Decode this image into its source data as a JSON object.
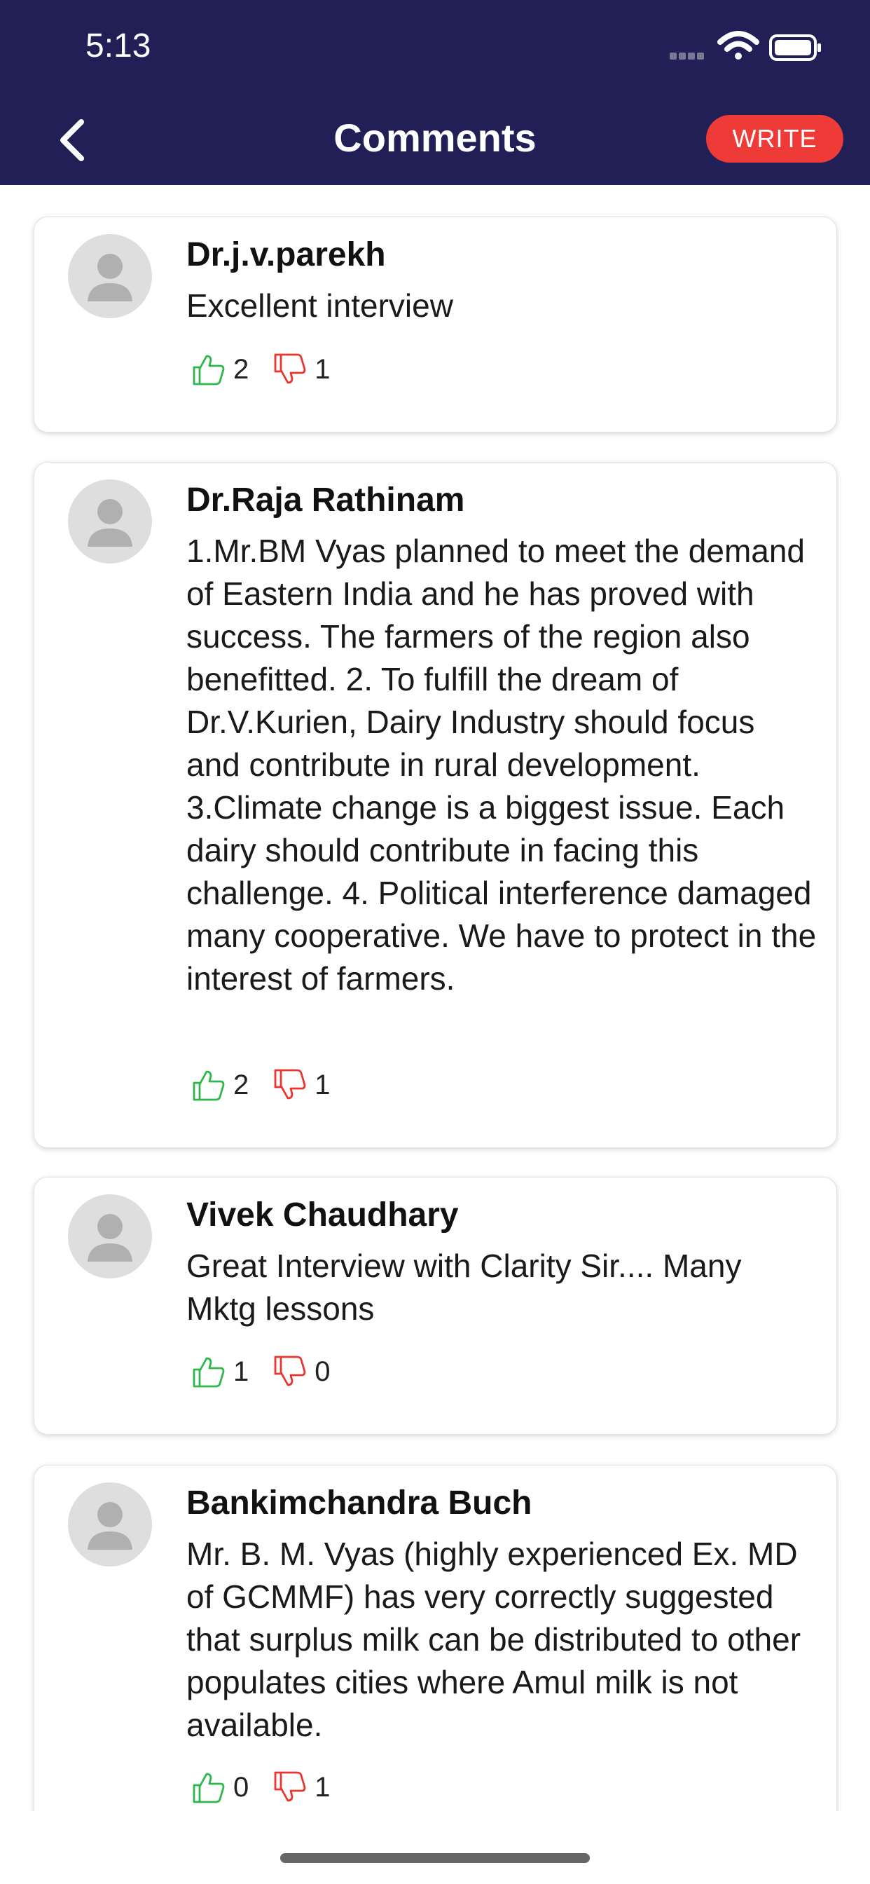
{
  "status_bar": {
    "time": "5:13"
  },
  "nav": {
    "title": "Comments",
    "write_label": "WRITE"
  },
  "comments": [
    {
      "author": "Dr.j.v.parekh",
      "text": "Excellent interview",
      "likes": "2",
      "dislikes": "1"
    },
    {
      "author": "Dr.Raja Rathinam",
      "text": "1.Mr.BM Vyas planned to meet the demand of Eastern India and he has proved with success. The farmers of the region also benefitted. 2. To fulfill the dream of Dr.V.Kurien, Dairy Industry should focus and contribute in rural development. 3.Climate change is a biggest issue. Each dairy should contribute in facing this challenge. 4. Political interference damaged many cooperative. We have to protect in the interest of farmers.",
      "likes": "2",
      "dislikes": "1"
    },
    {
      "author": "Vivek Chaudhary",
      "text": "Great Interview with Clarity Sir.... Many Mktg lessons",
      "likes": "1",
      "dislikes": "0"
    },
    {
      "author": "Bankimchandra Buch",
      "text": "Mr. B. M. Vyas (highly experienced Ex. MD of GCMMF) has very correctly suggested that surplus milk can be distributed to other populates cities where Amul milk is not available.",
      "likes": "0",
      "dislikes": "1"
    }
  ],
  "colors": {
    "header_bg": "#221f57",
    "write_button": "#ee3b37",
    "like_icon": "#2eb84a",
    "dislike_icon": "#e8352e"
  },
  "icons": {
    "back": "chevron-left-icon",
    "like": "thumbs-up-icon",
    "dislike": "thumbs-down-icon",
    "avatar": "person-silhouette-icon",
    "wifi": "wifi-icon",
    "battery": "battery-icon",
    "signal": "signal-icon"
  }
}
